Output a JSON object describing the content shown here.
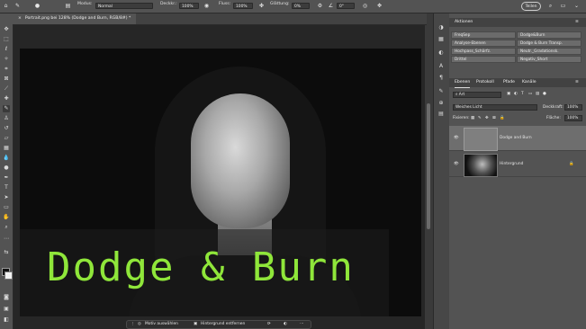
{
  "options_bar": {
    "mode_label": "Modus:",
    "mode_value": "Normal",
    "opacity_label": "Deckkr.:",
    "opacity_value": "100%",
    "flow_label": "Fluss:",
    "flow_value": "100%",
    "smoothing_label": "Glättung:",
    "smoothing_value": "0%",
    "angle_value": "0°",
    "share_label": "Teilen"
  },
  "document_tab": {
    "title": "Portrait.png bei 128% (Dodge and Burn, RGB/8#) *"
  },
  "overlay_text": "Dodge & Burn",
  "task_bar": {
    "select_subject": "Motiv auswählen",
    "remove_background": "Hintergrund entfernen"
  },
  "actions_panel": {
    "title": "Aktionen",
    "items": [
      "FreqSep",
      "Dodge&Burn",
      "Analyse-Ebenen",
      "Dodge & Burn Transp.",
      "Hochpass_Schärfz.",
      "Neutr._Gradationsk.",
      "Drittel",
      "Negativ_Short"
    ]
  },
  "layers_panel": {
    "tabs": [
      "Ebenen",
      "Protokoll",
      "Pfade",
      "Kanäle"
    ],
    "filter_value": "Art",
    "blend_mode": "Weiches Licht",
    "opacity_label": "Deckkraft:",
    "opacity_value": "100%",
    "lock_label": "Fixieren:",
    "fill_label": "Fläche:",
    "fill_value": "100%",
    "layers": [
      {
        "name": "Dodge and Burn"
      },
      {
        "name": "Hintergrund"
      }
    ]
  },
  "colors": {
    "accent_text": "#8fe63a",
    "panel_bg": "#535353"
  }
}
